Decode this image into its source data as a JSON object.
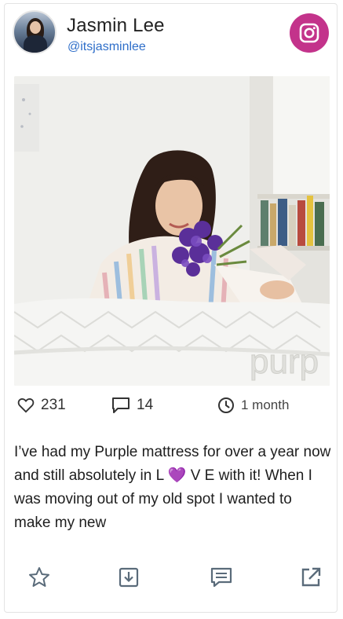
{
  "header": {
    "name": "Jasmin Lee",
    "handle": "@itsjasminlee"
  },
  "badge": {
    "icon": "instagram-icon",
    "color": "#c3338b"
  },
  "photo": {
    "visible_brand_text": "purp"
  },
  "stats": {
    "likes": "231",
    "comments": "14",
    "time": "1 month"
  },
  "caption": {
    "part1": "I’ve had my Purple mattress for over a year now and still absolutely in L ",
    "emoji": "💜",
    "part2": " V E with it! When I was moving out of my old spot I wanted to make my new"
  },
  "actions": [
    {
      "icon": "star-icon"
    },
    {
      "icon": "download-icon"
    },
    {
      "icon": "comment-icon"
    },
    {
      "icon": "external-link-icon"
    }
  ],
  "colors": {
    "link": "#2e6ec9",
    "icon": "#5a6b7a",
    "emoji_heart": "#9b4dff"
  }
}
